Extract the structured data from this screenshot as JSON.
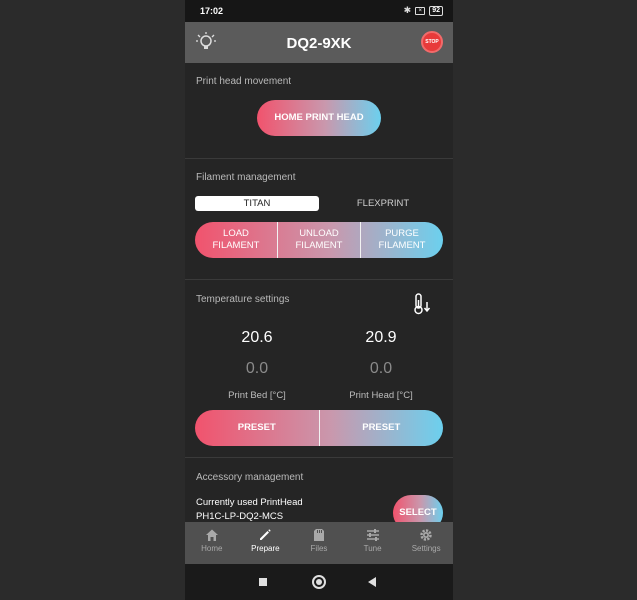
{
  "status": {
    "time": "17:02",
    "battery": "92",
    "bt_icon": "bluetooth-icon"
  },
  "appbar": {
    "title": "DQ2-9XK",
    "stop_label": "STOP"
  },
  "movement": {
    "title": "Print head movement",
    "home_label": "HOME PRINT HEAD"
  },
  "filament": {
    "title": "Filament management",
    "tabs": [
      "TITAN",
      "FLEXPRINT"
    ],
    "selected_tab": "TITAN",
    "buttons": [
      {
        "line1": "LOAD",
        "line2": "FILAMENT"
      },
      {
        "line1": "UNLOAD",
        "line2": "FILAMENT"
      },
      {
        "line1": "PURGE",
        "line2": "FILAMENT"
      }
    ]
  },
  "temperature": {
    "title": "Temperature settings",
    "bed": {
      "current": "20.6",
      "target": "0.0",
      "label": "Print Bed [°C]",
      "preset": "PRESET"
    },
    "head": {
      "current": "20.9",
      "target": "0.0",
      "label": "Print Head [°C]",
      "preset": "PRESET"
    }
  },
  "accessory": {
    "title": "Accessory management",
    "line1": "Currently used PrintHead",
    "line2": "PH1C-LP-DQ2-MCS",
    "select_label": "SELECT"
  },
  "nav": [
    {
      "label": "Home",
      "icon": "home-icon",
      "active": false
    },
    {
      "label": "Prepare",
      "icon": "pencil-icon",
      "active": true
    },
    {
      "label": "Files",
      "icon": "file-icon",
      "active": false
    },
    {
      "label": "Tune",
      "icon": "sliders-icon",
      "active": false
    },
    {
      "label": "Settings",
      "icon": "gear-icon",
      "active": false
    }
  ],
  "colors": {
    "gradient_start": "#f1536d",
    "gradient_end": "#6cd0ee",
    "stop": "#e83a3a"
  }
}
